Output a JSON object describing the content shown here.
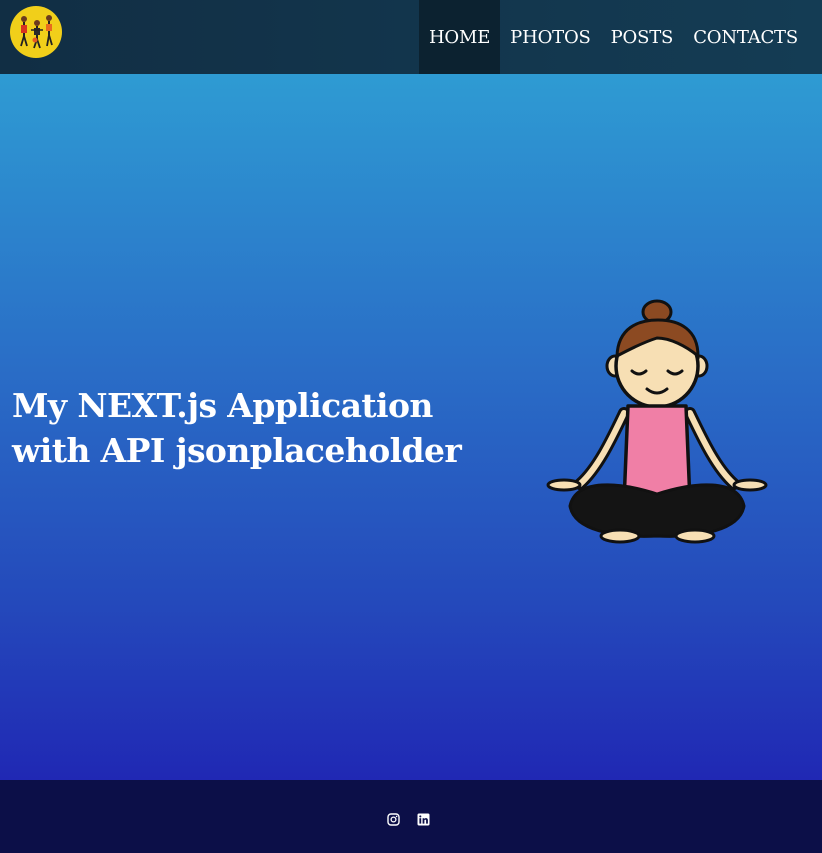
{
  "header": {
    "nav": {
      "home": "HOME",
      "photos": "PHOTOS",
      "posts": "POSTS",
      "contacts": "CONTACTS"
    },
    "active_item": "home"
  },
  "hero": {
    "title_line1": "My NEXT.js Application",
    "title_line2": "with API jsonplaceholder",
    "illustration": "meditating-woman"
  },
  "footer": {
    "social": [
      "instagram-icon",
      "linkedin-icon"
    ]
  },
  "colors": {
    "header_bg": "#133548",
    "nav_active_bg": "#0c2230",
    "hero_top": "#2e9bd3",
    "hero_bottom": "#2028b4",
    "footer_bg": "#0c0f48",
    "logo_bg": "#f1cf1a"
  }
}
